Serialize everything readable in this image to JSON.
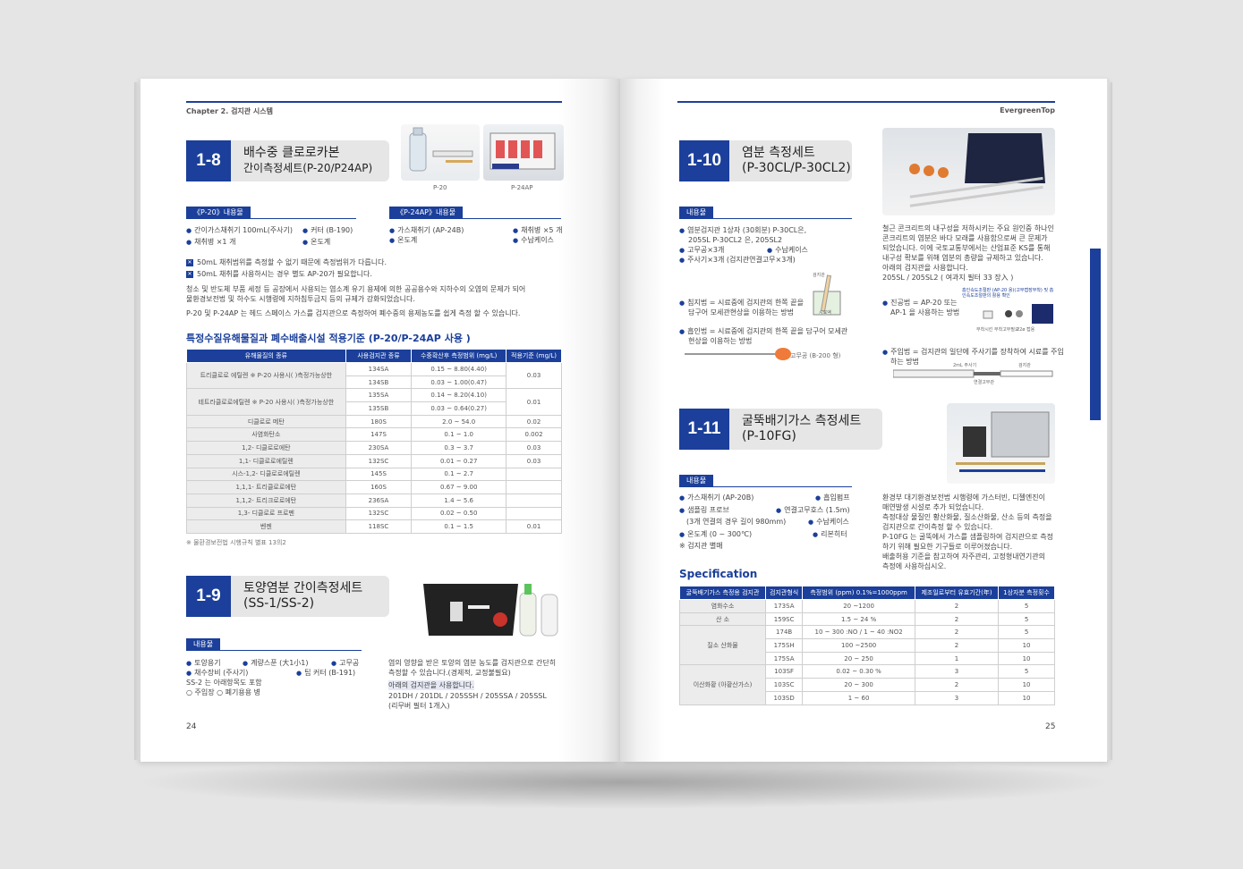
{
  "left": {
    "header": "Chapter 2. 검지관 시스템",
    "page_number": "24",
    "s18": {
      "number": "1-8",
      "title1": "배수중 클로로카본",
      "title2": "간이측정세트(P-20/P24AP)",
      "cap1": "P-20",
      "cap2": "P-24AP",
      "tag_a": "《P-20》내용물",
      "tag_b": "《P-24AP》내용물",
      "a1": "간이가스채취기 100mL(주사기)",
      "a2": "커터 (B-190)",
      "a3": "채취병 ×1 개",
      "a4": "온도계",
      "b1": "가스채취기 (AP-24B)",
      "b2": "채취병 ×5 개",
      "b3": "온도계",
      "b4": "수납케이스",
      "note1": "50mL 채취범위를 측정할 수 없기 때문에 측정범위가 다릅니다.",
      "note2": "50mL 채취를 사용하시는 경우 별도 AP-20가 필요합니다.",
      "p1": "청소 및 반도체 부품 세정 등 공장에서 사용되는 염소계 유기 용제에 의한 공공용수와 지하수의 오염의 문제가 되어",
      "p2": "물환경보전법 및 하수도 시행령에 지하침투금지 등의 규제가 강화되었습니다.",
      "p3": "P-20 및 P-24AP 는 헤드 스페이스 가스를 검지관으로 측정하여 폐수중의 용제농도를 쉽게 측정 할 수 있습니다.",
      "table_title": "특정수질유해물질과 폐수배출시설 적용기준 (P-20/P-24AP 사용 )",
      "table_note": "※ 물환경보전법 시행규칙 별표 13의2",
      "table": {
        "headers": [
          "유해물질의 종류",
          "사용검지관 종류",
          "수중확산후 측정범위 (mg/L)",
          "적용기준 (mg/L)"
        ],
        "r1": [
          "트리클로로 에틸렌 ※ P-20 사용시( )측정가능상한",
          "134SA",
          "0.15 ~ 8.80(4.40)",
          "0.03"
        ],
        "r2": [
          "134SB",
          "0.03 ~ 1.00(0.47)"
        ],
        "r3": [
          "테트라클로로에틸렌 ※ P-20 사용시( )측정가능상한",
          "135SA",
          "0.14 ~ 8.20(4.10)",
          "0.01"
        ],
        "r4": [
          "135SB",
          "0.03 ~ 0.64(0.27)"
        ],
        "r5": [
          "디클로로 메탄",
          "180S",
          "2.0 ~ 54.0",
          "0.02"
        ],
        "r6": [
          "사염화탄소",
          "147S",
          "0.1 ~ 1.0",
          "0.002"
        ],
        "r7": [
          "1,2- 디클로로에탄",
          "230SA",
          "0.3 ~ 3.7",
          "0.03"
        ],
        "r8": [
          "1,1- 디클로로에틸렌",
          "132SC",
          "0.01 ~ 0.27",
          "0.03"
        ],
        "r9": [
          "시스-1,2- 디클로로에틸렌",
          "145S",
          "0.1 ~ 2.7",
          ""
        ],
        "r10": [
          "1,1,1- 트리클로로에탄",
          "160S",
          "0.67 ~ 9.00",
          ""
        ],
        "r11": [
          "1,1,2- 트리크로로에탄",
          "236SA",
          "1.4 ~ 5.6",
          ""
        ],
        "r12": [
          "1,3- 디클로로 프로펜",
          "132SC",
          "0.02 ~ 0.50",
          ""
        ],
        "r13": [
          "벤젠",
          "118SC",
          "0.1 ~ 1.5",
          "0.01"
        ]
      }
    },
    "s19": {
      "number": "1-9",
      "title1": "토양염분 간이측정세트",
      "title2": "(SS-1/SS-2)",
      "tag": "내용물",
      "i1": "토양용기",
      "i2": "계량스푼 (大1小1)",
      "i3": "고무공",
      "i4": "채수장비 (주사기)",
      "i5": "팁 커터 (B-191)",
      "i6": "SS-2 는 아래항목도 포함",
      "i7": "○ 주입장 ○ 폐기용용 병",
      "d1": "염의 영향을 받은 토양의 염분 농도를 검지관으로 간단히",
      "d2": "측정할 수 있습니다.(경제적, 교정불필요)",
      "d3": "아래의 검지관을 사용합니다.",
      "d4": "201DH / 201DL / 205SSH / 205SSA / 205SSL",
      "d5": "(리무버 필터 1개入)"
    }
  },
  "right": {
    "header": "EvergreenTop",
    "page_number": "25",
    "s110": {
      "number": "1-10",
      "title1": "염분 측정세트",
      "title2": "(P-30CL/P-30CL2)",
      "tag": "내용물",
      "i1": "염분검지관 1상자 (30회분) P-30CL은,",
      "i2": "205SL P-30CL2 은, 205SL2",
      "i3": "고무공×3개",
      "i4": "수납케이스",
      "i5": "주사기×3개 (검지관연결고무×3개)",
      "m1a": "침지법 = 시료중에 검지관의 한쪽 끝을",
      "m1b": "담구어 모세관현상을 이용하는 방법",
      "m2a": "흡인법 = 시료중에 검지관의 한쪽 끝을 담구어 모세관",
      "m2b": "현상을 이용하는 방법",
      "lbl_rubber": "고무공 (B-200 형)",
      "lbl_tube": "검지관",
      "lbl_sample": "시료액",
      "d1": "철근 콘크리트의 내구성을 저하시키는 주요 원인중 하나인",
      "d2": "콘크리트의 염분은 바다 모래를 사용함으로써 큰 문제가",
      "d3": "되었습니다. 이에 국토교통부에서는 산업표준 KS를 통해",
      "d4": "내구성 확보를 위해 염분의 총량을 규제하고 있습니다.",
      "d5": "아래의 검지관을 사용합니다.",
      "d6": "205SL / 205SL2 ( 여과지 필터 33 장入 )",
      "m3a": "진공법 = AP-20 또는",
      "m3b": "AP-1 을 사용하는 방법",
      "small_note": "흡인속도조절판 (AP-20 용)(고무캡장부착) 및 흡인속도조절판의 활용 확인",
      "lbl_filter": "부착시킨 부착고무필요",
      "lbl_trap": "22ø 캡용",
      "m4a": "주입법 = 검지관의 일단에 주사기를 장착하여 시료를 주입",
      "m4b": "하는 방법",
      "lbl_syringe": "2mL 주사기",
      "lbl_conn": "연결고무관",
      "lbl_tube2": "검지관"
    },
    "s111": {
      "number": "1-11",
      "title1": "굴뚝배기가스 측정세트",
      "title2": "(P-10FG)",
      "tag": "내용물",
      "i1": "가스채취기 (AP-20B)",
      "i2": "흡입펌프",
      "i3": "샘플링 프로브",
      "i4": "연결고무호스 (1.5m)",
      "i5": "(3개 연결의 경우 길이 980mm)",
      "i6": "수납케이스",
      "i7": "온도계 (0 ~ 300℃)",
      "i8": "리본히터",
      "i9": "※ 검지관 별매",
      "d1": "환경부 대기환경보전법 시행령에 가스터빈, 디젤엔진이",
      "d2": "매연발생 시설로 추가 되었습니다.",
      "d3": "측정대상 물질인 황산화물, 질소산화물, 산소 등의 측정을",
      "d4": "검지관으로 간이측정 할 수 있습니다.",
      "d5": "P-10FG 는 굴뚝에서 가스를 샘플링하여 검지관으로 측정",
      "d6": "하기 위해 필요한 기구들로 이루어졌습니다.",
      "d7": "배출허용 기준을 참고하여 자주관리, 고정형내연기관의",
      "d8": "측정에 사용하십시오."
    },
    "spec": {
      "title": "Specification",
      "headers": [
        "굴뚝배기가스 측정용 검지관",
        "검지관형식",
        "측정범위 (ppm) 0.1%=1000ppm",
        "제조일로부터 유효기간(年)",
        "1상자분 측정횟수"
      ],
      "r1": [
        "염화수소",
        "173SA",
        "20 ~1200",
        "2",
        "5"
      ],
      "r2": [
        "산 소",
        "159SC",
        "1.5 ~ 24 %",
        "2",
        "5"
      ],
      "r3": [
        "질소 산화물",
        "174B",
        "10 ~ 300 :NO / 1 ~ 40 :NO2",
        "2",
        "5"
      ],
      "r4": [
        "175SH",
        "100 ~2500",
        "2",
        "10"
      ],
      "r5": [
        "175SA",
        "20 ~ 250",
        "1",
        "10"
      ],
      "r6": [
        "이산화황 (아황산가스)",
        "103SF",
        "0.02 ~ 0.30 %",
        "3",
        "5"
      ],
      "r7": [
        "103SC",
        "20 ~ 300",
        "2",
        "10"
      ],
      "r8": [
        "103SD",
        "1 ~ 60",
        "3",
        "10"
      ]
    }
  }
}
